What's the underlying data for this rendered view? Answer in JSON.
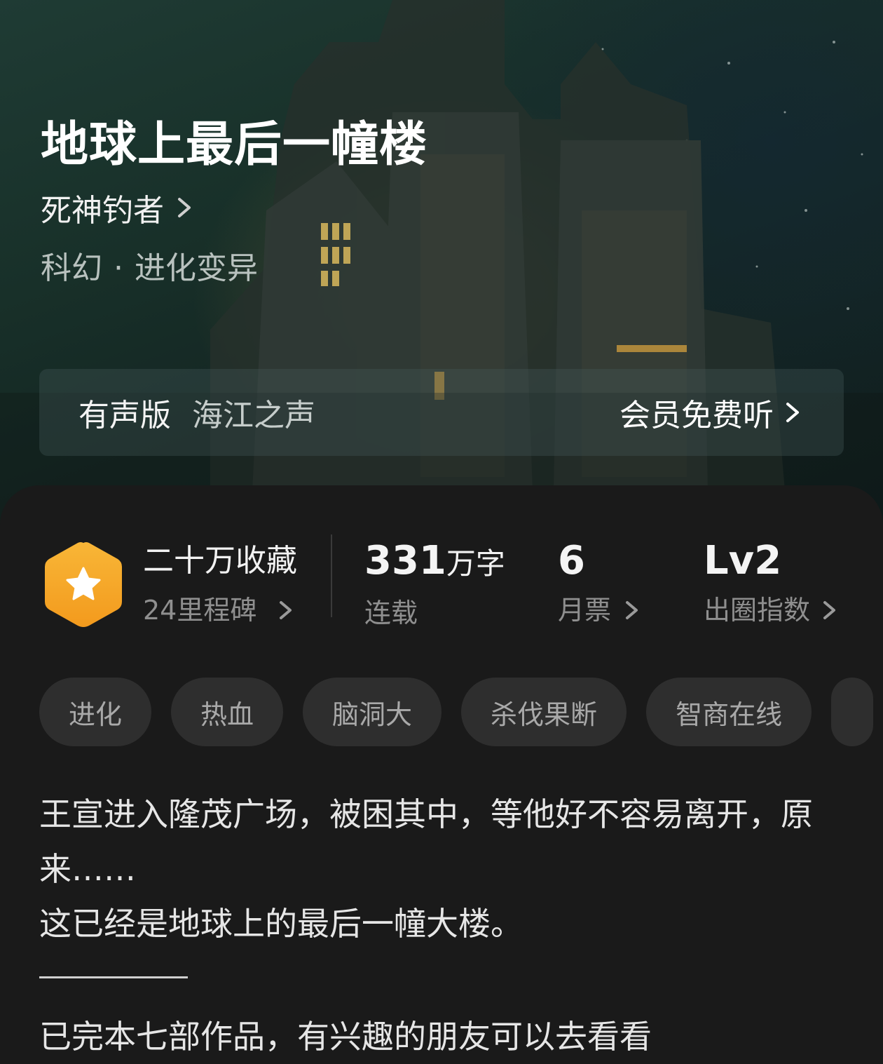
{
  "book": {
    "title": "地球上最后一幢楼",
    "author": "死神钓者",
    "genre_main": "科幻",
    "genre_separator": "·",
    "genre_sub": "进化变异"
  },
  "audio": {
    "label": "有声版",
    "narrator": "海江之声",
    "cta": "会员免费听"
  },
  "stats": {
    "collections": "二十万收藏",
    "milestones": "24里程碑",
    "word_count": "331",
    "word_unit": "万字",
    "status": "连载",
    "monthly_votes": "6",
    "monthly_votes_label": "月票",
    "level": "Lv2",
    "level_label": "出圈指数"
  },
  "tags": [
    "进化",
    "热血",
    "脑洞大",
    "杀伐果断",
    "智商在线"
  ],
  "description": {
    "line1": "王宣进入隆茂广场，被困其中，等他好不容易离开，原来……",
    "line2": "这已经是地球上的最后一幢大楼。",
    "line3": "已完本七部作品，有兴趣的朋友可以去看看"
  },
  "colors": {
    "badge": "#F5A623",
    "sheet_bg": "#1a1a1a",
    "tag_bg": "#2e2e2e"
  },
  "icons": {
    "badge": "star-hexagon-icon",
    "chevron": "chevron-right-icon"
  }
}
